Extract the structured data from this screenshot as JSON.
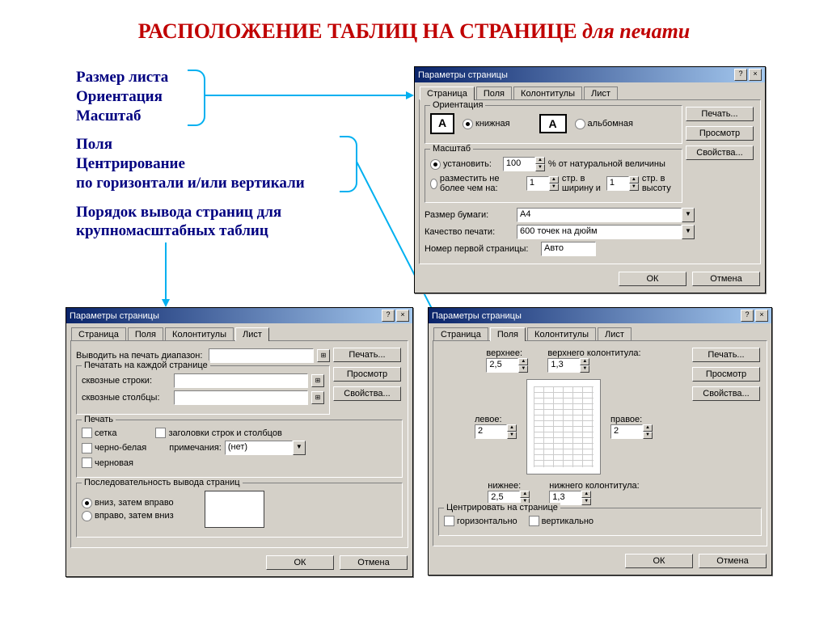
{
  "title_main": "РАСПОЛОЖЕНИЕ ТАБЛИЦ НА СТРАНИЦЕ ",
  "title_italic": "для печати",
  "annotations": {
    "g1": [
      "Размер листа",
      "Ориентация",
      "Масштаб"
    ],
    "g2": [
      "Поля",
      "Центрирование",
      "по горизонтали и/или вертикали"
    ],
    "g3": [
      "Порядок вывода страниц для",
      "крупномасштабных таблиц"
    ]
  },
  "common": {
    "dialog_title": "Параметры страницы",
    "tabs": {
      "page": "Страница",
      "fields": "Поля",
      "headers": "Колонтитулы",
      "sheet": "Лист"
    },
    "btn_print": "Печать...",
    "btn_preview": "Просмотр",
    "btn_props": "Свойства...",
    "btn_ok": "ОК",
    "btn_cancel": "Отмена",
    "help_q": "?",
    "close_x": "×"
  },
  "dlg_page": {
    "orientation_legend": "Ориентация",
    "portrait": "книжная",
    "landscape": "альбомная",
    "scale_legend": "Масштаб",
    "set_to": "установить:",
    "set_val": "100",
    "set_suffix": "% от натуральной величины",
    "fit_to": "разместить не более чем на:",
    "fit_w": "1",
    "fit_w_label": "стр. в ширину и",
    "fit_h": "1",
    "fit_h_label": "стр. в высоту",
    "paper_label": "Размер бумаги:",
    "paper_val": "A4",
    "quality_label": "Качество печати:",
    "quality_val": "600 точек на дюйм",
    "firstpage_label": "Номер первой страницы:",
    "firstpage_val": "Авто"
  },
  "dlg_sheet": {
    "print_range": "Выводить на печать диапазон:",
    "each_page": "Печатать на каждой странице",
    "through_rows": "сквозные строки:",
    "through_cols": "сквозные столбцы:",
    "print_legend": "Печать",
    "grid": "сетка",
    "bw": "черно-белая",
    "draft": "черновая",
    "rowcol_headers": "заголовки строк и столбцов",
    "notes_label": "примечания:",
    "notes_val": "(нет)",
    "order_legend": "Последовательность вывода страниц",
    "down_then_over": "вниз, затем вправо",
    "over_then_down": "вправо, затем вниз"
  },
  "dlg_margins": {
    "top": "верхнее:",
    "top_val": "2,5",
    "header": "верхнего колонтитула:",
    "header_val": "1,3",
    "left": "левое:",
    "left_val": "2",
    "right": "правое:",
    "right_val": "2",
    "bottom": "нижнее:",
    "bottom_val": "2,5",
    "footer": "нижнего колонтитула:",
    "footer_val": "1,3",
    "center_legend": "Центрировать на странице",
    "horiz": "горизонтально",
    "vert": "вертикально"
  }
}
